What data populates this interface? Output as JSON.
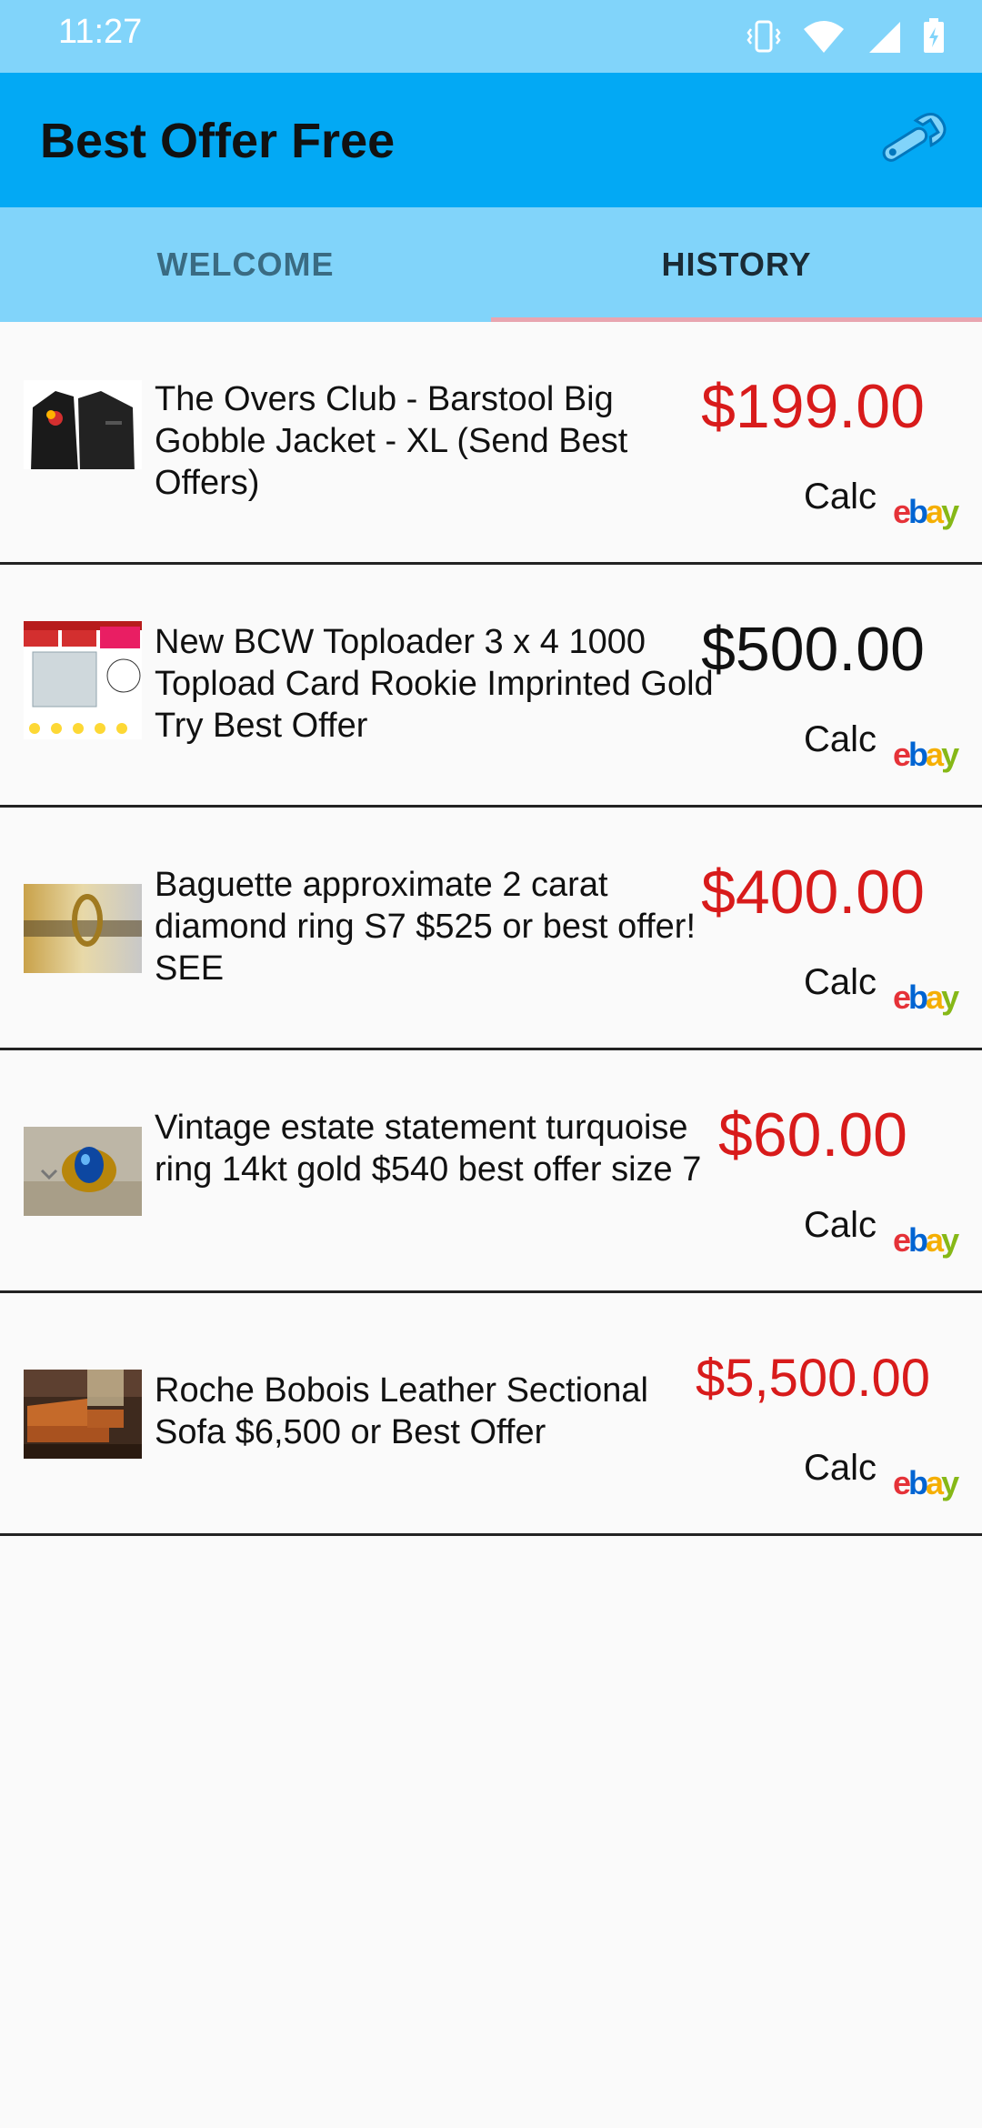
{
  "status": {
    "time": "11:27"
  },
  "app": {
    "title": "Best Offer Free"
  },
  "tabs": [
    {
      "label": "WELCOME",
      "selected": false
    },
    {
      "label": "HISTORY",
      "selected": true
    }
  ],
  "colors": {
    "price_red": "#d81b1b",
    "appbar": "#03a9f4",
    "tabs_bg": "#81d4fa"
  },
  "items": [
    {
      "title": "The Overs Club - Barstool Big Gobble Jacket - XL (Send Best Offers)",
      "price": "$199.00",
      "price_color": "red",
      "calc": "Calc",
      "brand": "ebay"
    },
    {
      "title": "New BCW Toploader 3 x 4 1000 Topload Card Rookie Imprinted Gold Try Best Offer",
      "price": "$500.00",
      "price_color": "black",
      "calc": "Calc",
      "brand": "ebay"
    },
    {
      "title": "Baguette approximate 2 carat diamond ring S7 $525 or best offer!  SEE",
      "price": "$400.00",
      "price_color": "red",
      "calc": "Calc",
      "brand": "ebay"
    },
    {
      "title": "Vintage estate statement turquoise ring 14kt gold $540 best offer size 7",
      "price": "$60.00",
      "price_color": "red",
      "calc": "Calc",
      "brand": "ebay"
    },
    {
      "title": "Roche Bobois Leather Sectional Sofa $6,500 or Best Offer",
      "price": "$5,500.00",
      "price_color": "red",
      "calc": "Calc",
      "brand": "ebay"
    }
  ]
}
